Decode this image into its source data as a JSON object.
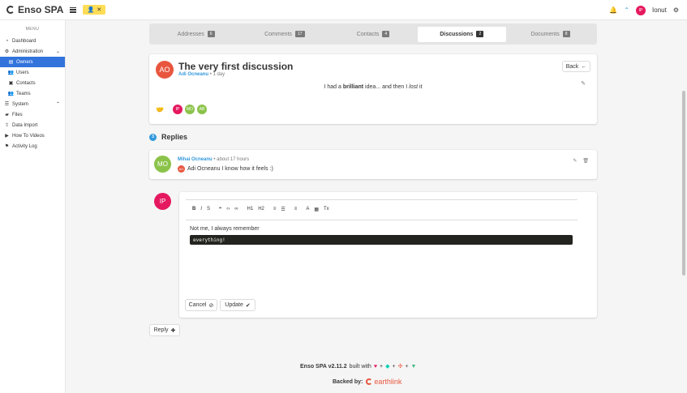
{
  "navbar": {
    "brand": "Enso SPA",
    "user_initials": "IP",
    "user_name": "Ionut"
  },
  "sidebar": {
    "menu_label": "MENU",
    "items": [
      {
        "label": "Dashboard",
        "icon": "dashboard-icon"
      },
      {
        "label": "Administration",
        "icon": "cogs-icon"
      },
      {
        "label": "Owners",
        "icon": "owners-icon"
      },
      {
        "label": "Users",
        "icon": "users-icon"
      },
      {
        "label": "Contacts",
        "icon": "contacts-icon"
      },
      {
        "label": "Teams",
        "icon": "teams-icon"
      },
      {
        "label": "System",
        "icon": "list-icon"
      },
      {
        "label": "Files",
        "icon": "folder-icon"
      },
      {
        "label": "Data Import",
        "icon": "import-icon"
      },
      {
        "label": "How To Videos",
        "icon": "video-icon"
      },
      {
        "label": "Activity Log",
        "icon": "activity-icon"
      }
    ]
  },
  "tabs": [
    {
      "label": "Addresses",
      "count": "6"
    },
    {
      "label": "Comments",
      "count": "17"
    },
    {
      "label": "Contacts",
      "count": "4"
    },
    {
      "label": "Discussions",
      "count": "2"
    },
    {
      "label": "Documents",
      "count": "8"
    }
  ],
  "discussion": {
    "avatar": "AO",
    "title": "The very first discussion",
    "author": "Adi Ocneanu",
    "time": "• 1 day",
    "back_label": "Back",
    "body_pre": "I had a ",
    "body_bold": "brilliant",
    "body_mid": " idea... and then I ",
    "body_italic": "lost",
    "body_post": " it",
    "participants": [
      {
        "initials": "IP",
        "color": "#e5195f"
      },
      {
        "initials": "MO",
        "color": "#8bc34a"
      },
      {
        "initials": "AB",
        "color": "#8bc34a"
      }
    ]
  },
  "replies": {
    "count": "3",
    "title": "Replies",
    "items": [
      {
        "avatar": "MO",
        "author": "Mihai Ocneanu",
        "time": "• about 17 hours",
        "mention_avatar": "AO",
        "text": "Adi Ocneanu I know how it feels :)"
      }
    ]
  },
  "editor": {
    "avatar": "IP",
    "toolbar": [
      "B",
      "I",
      "S",
      "❞",
      "</>",
      "🔗",
      "H1",
      "H2",
      "≡",
      "☰",
      "≡",
      "A",
      "A",
      "Tx"
    ],
    "text": "Not me, I always remember",
    "code": "everything!",
    "cancel_label": "Cancel",
    "update_label": "Update"
  },
  "reply_button": "Reply",
  "footer": {
    "version": "Enso SPA v2.11.2",
    "built_with": "built with",
    "plus": "+",
    "backed_by": "Backed by:",
    "sponsor": "earthlink"
  },
  "colors": {
    "primary": "#3273dc",
    "info": "#3298dc",
    "warning": "#ffdd57",
    "danger": "#e5195f",
    "success": "#8bc34a"
  }
}
